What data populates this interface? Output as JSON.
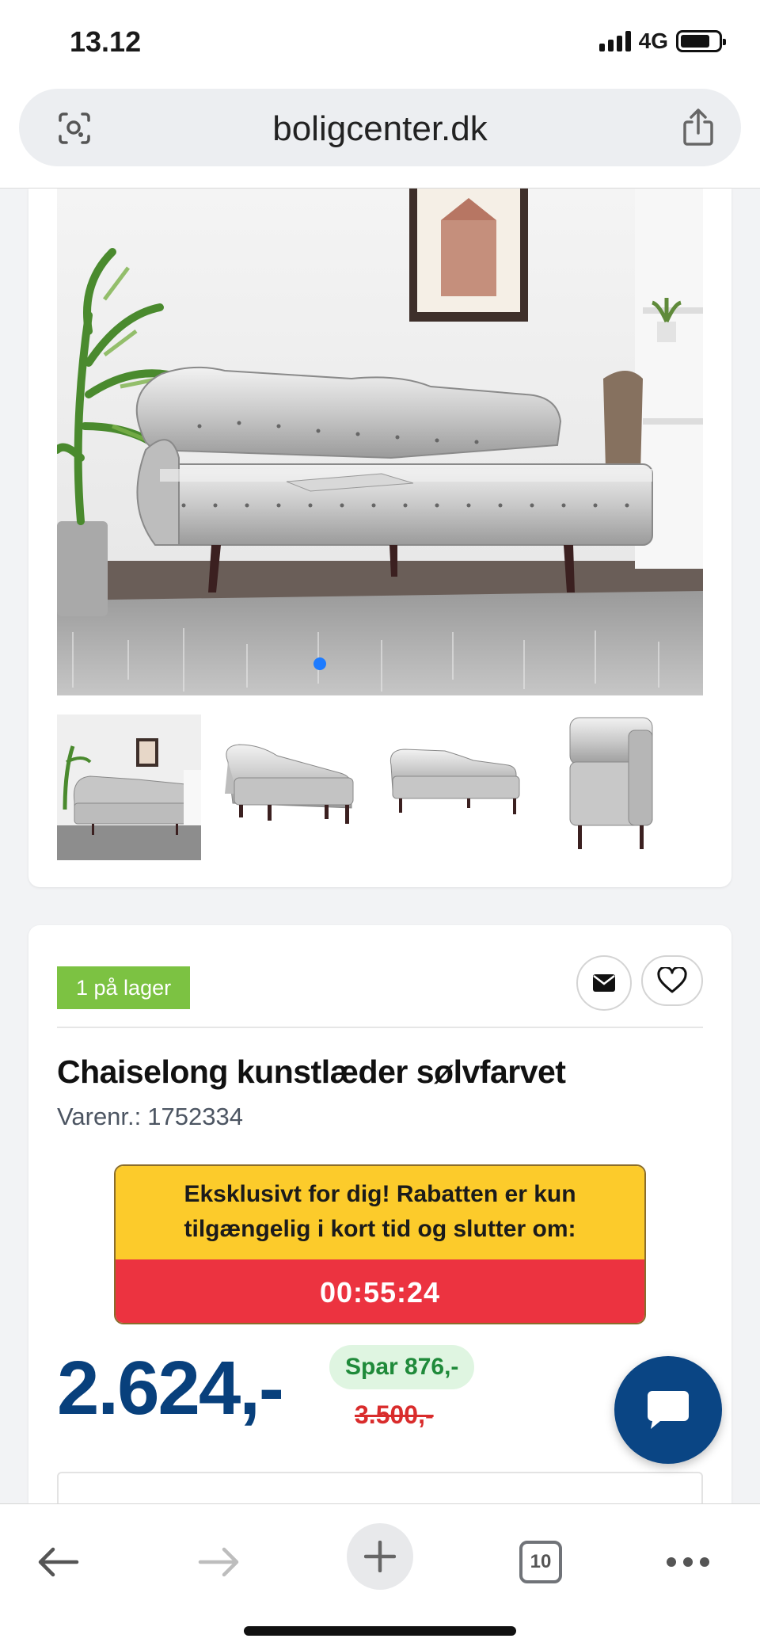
{
  "status_bar": {
    "time": "13.12",
    "network": "4G"
  },
  "browser": {
    "url": "boligcenter.dk",
    "tab_count": "10"
  },
  "gallery": {
    "active_index": 0,
    "thumbnail_count": 4
  },
  "product": {
    "stock": "1 på lager",
    "title": "Chaiselong kunstlæder sølvfarvet",
    "sku_label": "Varenr.:",
    "sku": "1752334",
    "promo_line1": "Eksklusivt for dig! Rabatten er kun",
    "promo_line2": "tilgængelig i kort tid og slutter om:",
    "countdown": "00:55:24",
    "price": "2.624,-",
    "savings": "Spar 876,-",
    "old_price": "3.500,-"
  },
  "icons": {
    "mail": "envelope-icon",
    "favorite": "heart-icon",
    "chat": "chat-bubble-icon",
    "share": "share-icon",
    "lens": "lens-icon"
  },
  "colors": {
    "price": "#08407c",
    "stock_badge": "#7cc242",
    "promo_yellow": "#fccb2b",
    "promo_red": "#ec3340",
    "savings_text": "#1f8a3a",
    "old_price": "#d92c2c",
    "chat_fab": "#0a4584"
  }
}
